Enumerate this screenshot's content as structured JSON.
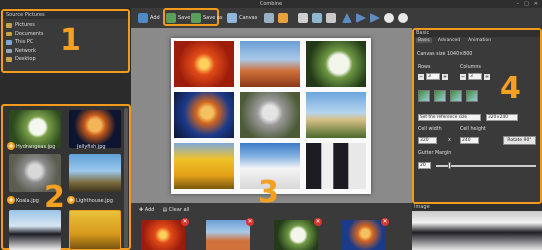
{
  "window": {
    "title": "Combine"
  },
  "toolbar": {
    "add": "Add",
    "save": "Save",
    "save_as": "Save as",
    "canvas": "Canvas"
  },
  "source_panel": {
    "title": "Source Pictures",
    "items": [
      "Pictures",
      "Documents",
      "This PC",
      "Network",
      "Desktop"
    ]
  },
  "thumbs": {
    "labels": [
      "Hydrangeas.jpg",
      "Jellyfish.jpg",
      "Koala.jpg",
      "Lighthouse.jpg"
    ]
  },
  "strip": {
    "add": "Add",
    "clear_all": "Clear all"
  },
  "right_panel": {
    "title": "Basic",
    "tabs": [
      "Basic",
      "Advanced",
      "Animation"
    ],
    "canvas_size": "Canvas size 1040×800",
    "rows_label": "Rows",
    "rows_value": "3",
    "columns_label": "Columns",
    "columns_value": "3",
    "reference_select": "Set the reference size",
    "size_select": "320×240",
    "cell_width_label": "Cell width",
    "cell_width_value": "320",
    "cell_height_label": "Cell height",
    "cell_height_value": "240",
    "times": "x",
    "rotate": "Rotate 90°",
    "gutter_label": "Gutter Margin",
    "gutter_value": "20"
  },
  "image_panel": {
    "title": "Image"
  },
  "callouts": [
    "1",
    "2",
    "3",
    "4"
  ],
  "colors": {
    "accent": "#f29a1c",
    "background": "#2b2b2b",
    "canvas": "#8a8a8a"
  }
}
